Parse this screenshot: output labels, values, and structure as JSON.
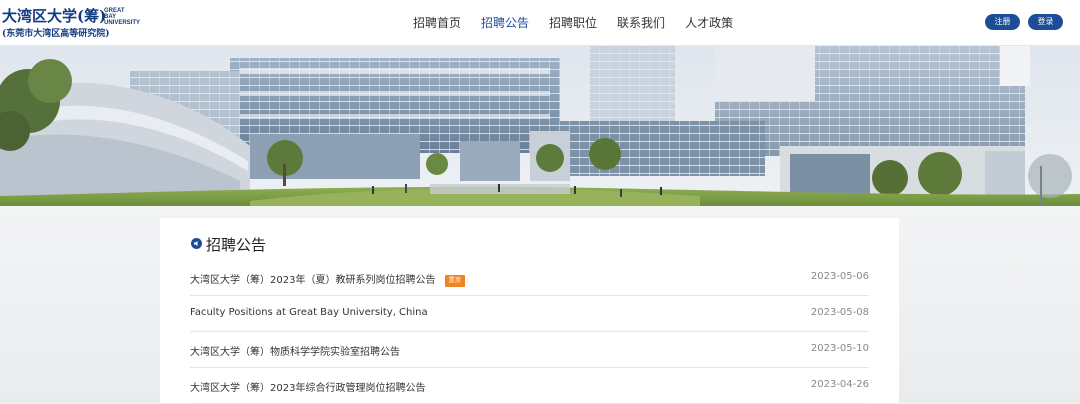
{
  "header": {
    "logo_zh": "大湾区大学(筹)",
    "logo_en_line1": "GREAT BAY",
    "logo_en_line2": "UNIVERSITY",
    "logo_sub": "(东莞市大湾区高等研究院)",
    "nav": [
      {
        "label": "招聘首页",
        "active": false
      },
      {
        "label": "招聘公告",
        "active": true
      },
      {
        "label": "招聘职位",
        "active": false
      },
      {
        "label": "联系我们",
        "active": false
      },
      {
        "label": "人才政策",
        "active": false
      }
    ],
    "register_label": "注册",
    "login_label": "登录"
  },
  "announcements": {
    "title": "招聘公告",
    "items": [
      {
        "title": "大湾区大学（筹）2023年（夏）教研系列岗位招聘公告",
        "badge": "置顶",
        "date": "2023-05-06"
      },
      {
        "title": "Faculty Positions at Great Bay University, China",
        "date": "2023-05-08"
      },
      {
        "title": "大湾区大学（筹）物质科学学院实验室招聘公告",
        "date": "2023-05-10"
      },
      {
        "title": "大湾区大学（筹）2023年综合行政管理岗位招聘公告",
        "date": "2023-04-26"
      }
    ]
  },
  "colors": {
    "brand": "#1d4d96",
    "badge": "#f08422"
  }
}
